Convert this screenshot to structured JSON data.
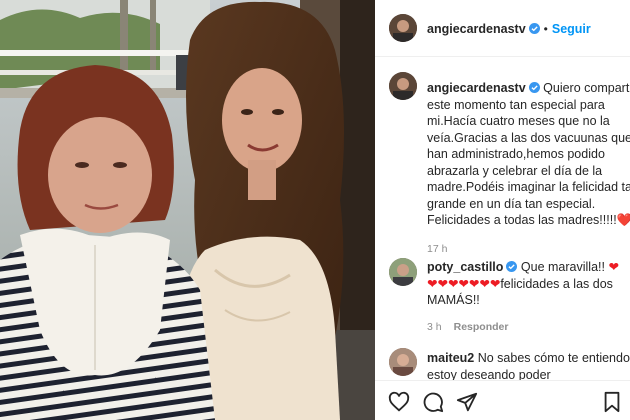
{
  "header": {
    "username": "angiecardenastv",
    "separator": "•",
    "follow_label": "Seguir"
  },
  "caption": {
    "username": "angiecardenastv",
    "text": "Quiero compartir este momento tan especial para mi.Hacía cuatro meses que no la veía.Gracias a las dos vacuunas que han administrado,hemos podido abrazarla y celebrar el día de la madre.Podéis imaginar la felicidad tan grande en un día tan especial. Felicidades a todas las madres!!!!!",
    "emoji": "❤️",
    "time": "17 h"
  },
  "comments": [
    {
      "username": "poty_castillo",
      "verified": true,
      "text": "Que maravilla!!",
      "hearts_inline": "❤",
      "hearts_row": "❤❤❤❤❤❤❤",
      "text2": "felicidades a las dos MAMÁS!!",
      "time": "3 h",
      "reply_label": "Responder"
    },
    {
      "username": "maiteu2",
      "verified": false,
      "text": "No sabes cómo te entiendo, estoy deseando poder"
    }
  ],
  "icons": {
    "like": "heart-outline-icon",
    "comment": "comment-icon",
    "share": "paper-plane-icon",
    "save": "bookmark-icon",
    "verified": "verified-badge-icon"
  },
  "colors": {
    "link_blue": "#0095f6",
    "verified_blue": "#3897f0",
    "secondary_text": "#8e8e8e",
    "heart_red": "#ed1c24"
  }
}
